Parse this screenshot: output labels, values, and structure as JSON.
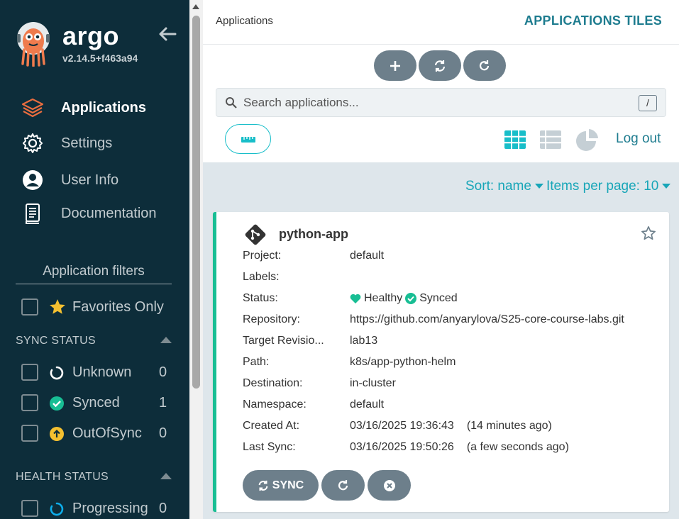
{
  "sidebar": {
    "brand": "argo",
    "version": "v2.14.5+f463a94",
    "nav": [
      {
        "label": "Applications",
        "icon": "stack-icon",
        "active": true
      },
      {
        "label": "Settings",
        "icon": "gear-icon",
        "active": false
      },
      {
        "label": "User Info",
        "icon": "user-icon",
        "active": false
      },
      {
        "label": "Documentation",
        "icon": "book-icon",
        "active": false
      }
    ],
    "filters_title": "Application filters",
    "favorites_label": "Favorites Only",
    "sync_status": {
      "title": "SYNC STATUS",
      "items": [
        {
          "label": "Unknown",
          "count": "0"
        },
        {
          "label": "Synced",
          "count": "1"
        },
        {
          "label": "OutOfSync",
          "count": "0"
        }
      ]
    },
    "health_status": {
      "title": "HEALTH STATUS",
      "items": [
        {
          "label": "Progressing",
          "count": "0"
        }
      ]
    }
  },
  "header": {
    "breadcrumb": "Applications",
    "view_title": "APPLICATIONS TILES"
  },
  "search": {
    "placeholder": "Search applications...",
    "shortcut": "/"
  },
  "toolbar": {
    "logout": "Log out",
    "sort_label": "Sort: name",
    "items_per_page_label": "Items per page: 10"
  },
  "app": {
    "name": "python-app",
    "fields": [
      {
        "key": "Project:",
        "value": "default"
      },
      {
        "key": "Labels:",
        "value": ""
      },
      {
        "key": "Status:",
        "health": "Healthy",
        "sync": "Synced"
      },
      {
        "key": "Repository:",
        "value": "https://github.com/anyarylova/S25-core-course-labs.git"
      },
      {
        "key": "Target Revisio...",
        "value": "lab13"
      },
      {
        "key": "Path:",
        "value": "k8s/app-python-helm"
      },
      {
        "key": "Destination:",
        "value": "in-cluster"
      },
      {
        "key": "Namespace:",
        "value": "default"
      },
      {
        "key": "Created At:",
        "value": "03/16/2025 19:36:43",
        "relative": "(14 minutes ago)"
      },
      {
        "key": "Last Sync:",
        "value": "03/16/2025 19:50:26",
        "relative": "(a few seconds ago)"
      }
    ],
    "sync_button": "SYNC"
  },
  "colors": {
    "sidebar_bg": "#0d2d3a",
    "accent": "#18bec9",
    "healthy": "#18be94",
    "button_gray": "#6d7f8b",
    "orange": "#e96d3f",
    "warning": "#f4c030"
  }
}
